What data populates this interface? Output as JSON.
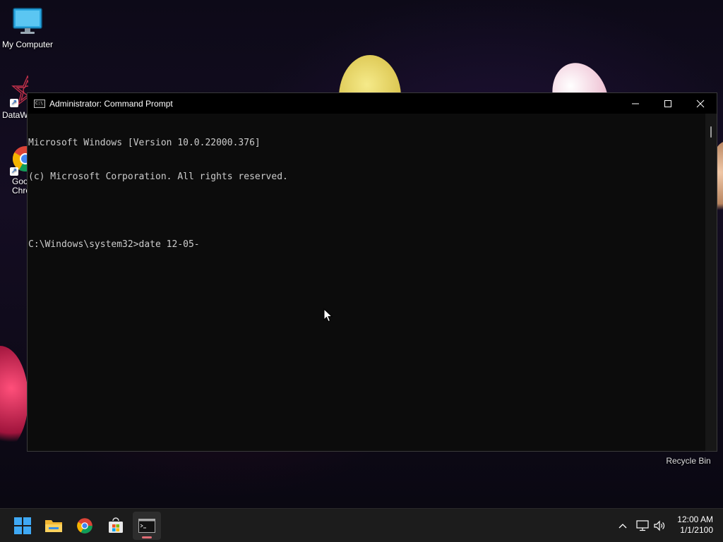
{
  "desktop": {
    "icons": [
      {
        "label": "My Computer"
      },
      {
        "label": "DataW"
      },
      {
        "label": "Goo\nChro"
      }
    ],
    "recycle_bin": "Recycle Bin"
  },
  "window": {
    "title": "Administrator: Command Prompt",
    "minimize_icon": "minimize-icon",
    "maximize_icon": "maximize-icon",
    "close_icon": "close-icon",
    "console_lines": [
      "Microsoft Windows [Version 10.0.22000.376]",
      "(c) Microsoft Corporation. All rights reserved.",
      "",
      "C:\\Windows\\system32>date 12-05-"
    ]
  },
  "taskbar": {
    "apps": [
      "start",
      "file-explorer",
      "chrome",
      "microsoft-store",
      "command-prompt"
    ],
    "active_app": "command-prompt",
    "time": "12:00 AM",
    "date": "1/1/2100"
  },
  "colors": {
    "console_bg": "#0c0c0c",
    "console_text": "#cccccc",
    "taskbar_bg": "#1c1c1c",
    "start_blue": "#3fa9f5",
    "active_indicator": "#e06c75"
  }
}
